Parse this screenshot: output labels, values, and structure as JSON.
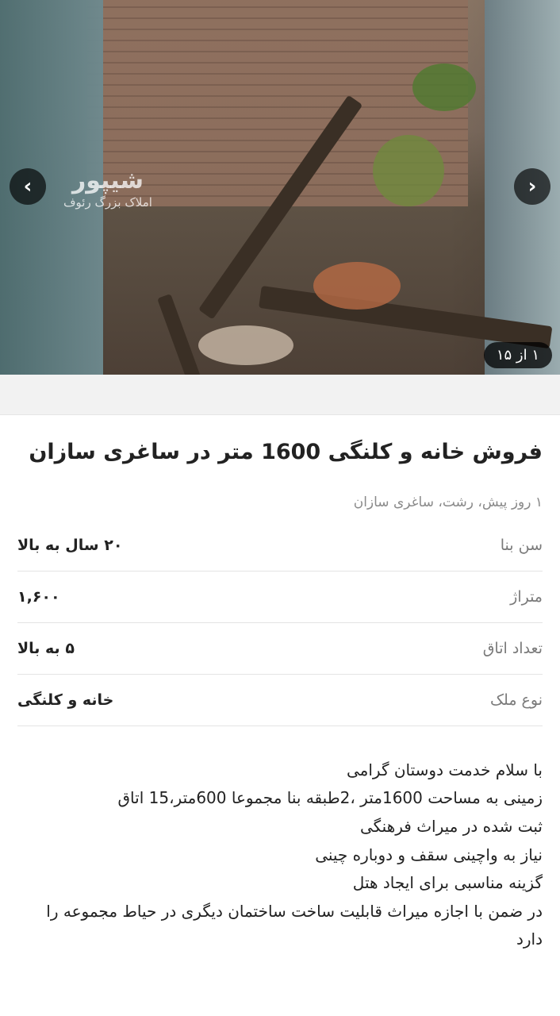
{
  "gallery": {
    "counter": "۱ از ۱۵",
    "watermark_brand": "شیپور",
    "watermark_sub": "املاک بزرگ رئوف",
    "prev_icon": "chevron-left-icon",
    "next_icon": "chevron-right-icon"
  },
  "listing": {
    "title": "فروش خانه و کلنگی 1600 متر در ساغری سازان",
    "meta": "۱ روز پیش، رشت، ساغری سازان",
    "details": [
      {
        "label": "سن بنا",
        "value": "۲۰ سال به بالا"
      },
      {
        "label": "متراژ",
        "value": "۱,۶۰۰"
      },
      {
        "label": "تعداد اتاق",
        "value": "۵ به بالا"
      },
      {
        "label": "نوع ملک",
        "value": "خانه و کلنگی"
      }
    ],
    "description": [
      "با سلام خدمت دوستان گرامی",
      "زمینی به مساحت 1600متر ،2طبقه بنا مجموعا 600متر،15 اتاق",
      "ثبت شده در میراث فرهنگی",
      "نیاز به واچینی سقف و دوباره چینی",
      "گزینه مناسبی برای ایجاد هتل",
      "در ضمن با اجازه میراث قابلیت ساخت ساختمان دیگری در حیاط مجموعه را دارد"
    ]
  }
}
